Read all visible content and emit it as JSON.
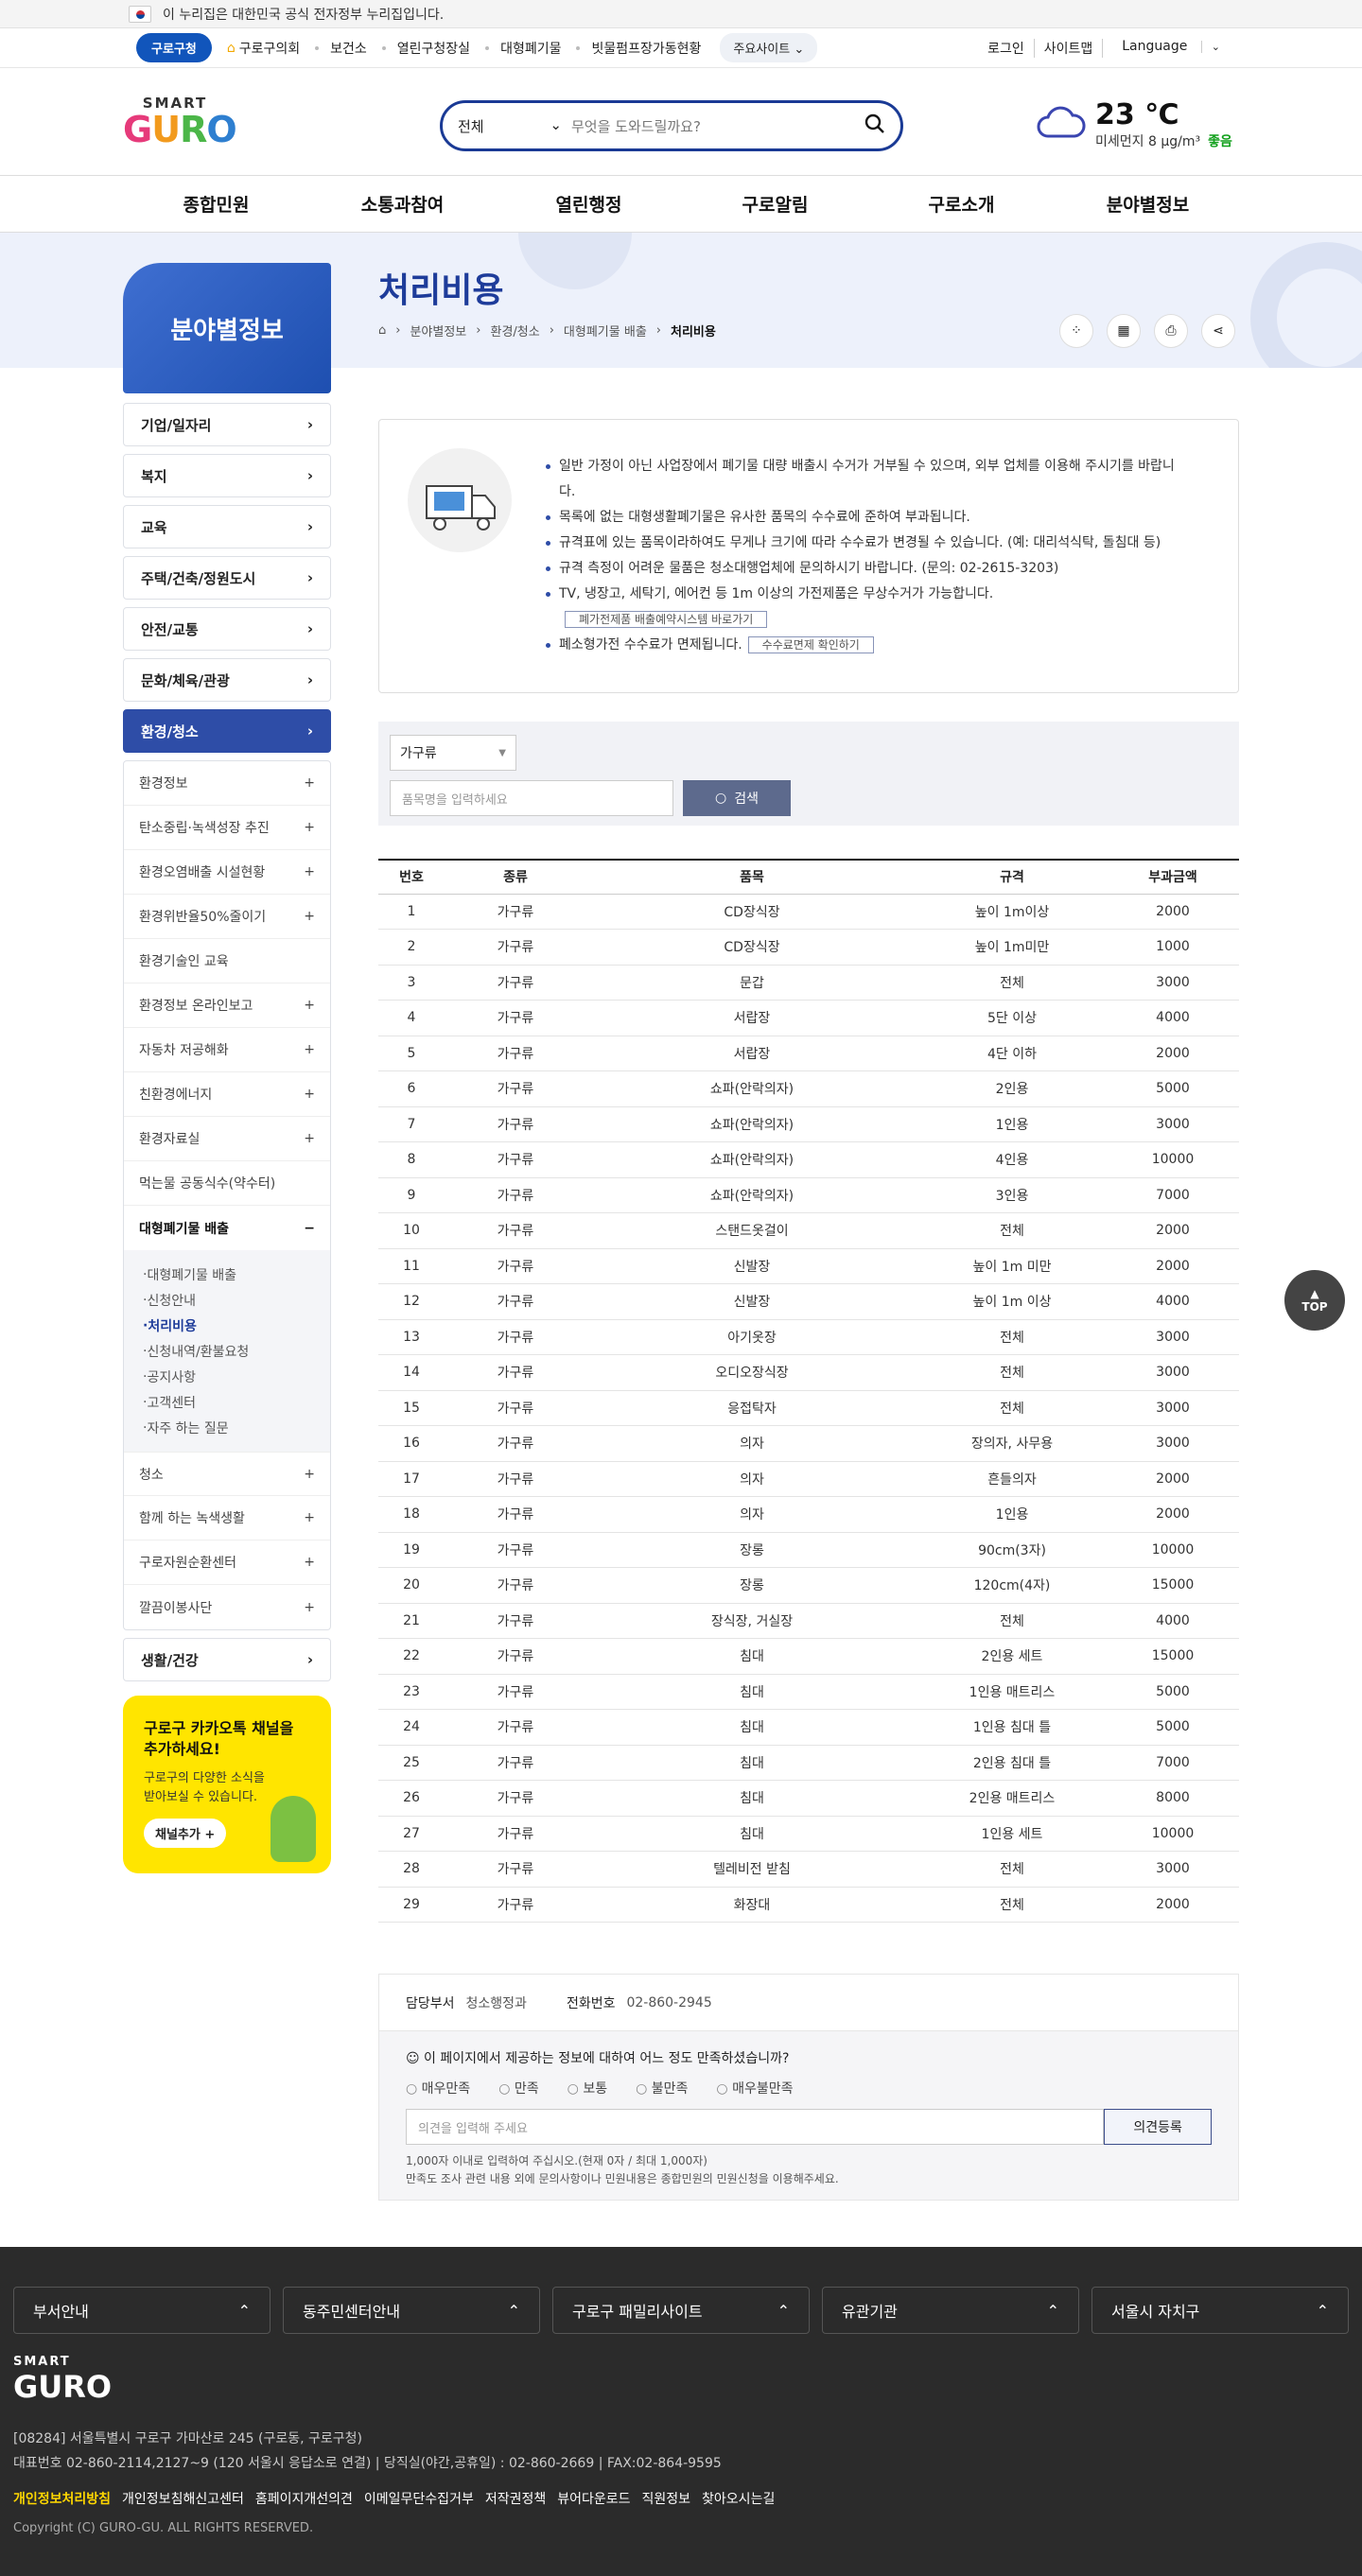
{
  "top": {
    "notice": "이 누리집은 대한민국 공식 전자정부 누리집입니다."
  },
  "gnbtop": {
    "guro": "구로구청",
    "links": [
      "구로구의회",
      "보건소",
      "열린구청장실",
      "대형폐기물",
      "빗물펌프장가동현황"
    ],
    "main_sites": "주요사이트",
    "util": [
      "로그인",
      "사이트맵",
      "Language"
    ]
  },
  "logo": {
    "smart": "SMART",
    "guro": "GURO"
  },
  "search": {
    "select": "전체",
    "placeholder": "무엇을 도와드릴까요?"
  },
  "weather": {
    "temp": "23 ℃",
    "dust": "미세먼지 8 µg/m³",
    "grade": "좋음"
  },
  "gnb": [
    "종합민원",
    "소통과참여",
    "열린행정",
    "구로알림",
    "구로소개",
    "분야별정보"
  ],
  "side_title": "분야별정보",
  "page_title": "처리비용",
  "breadcrumb": [
    "분야별정보",
    "환경/청소",
    "대형폐기물 배출",
    "처리비용"
  ],
  "lnb": {
    "top": [
      "기업/일자리",
      "복지",
      "교육",
      "주택/건축/정원도시",
      "안전/교통",
      "문화/체육/관광"
    ],
    "active": "환경/청소",
    "subs": [
      "환경정보",
      "탄소중립·녹색성장 추진",
      "환경오염배출 시설현황",
      "환경위반율50%줄이기",
      "환경기술인 교육",
      "환경정보 온라인보고",
      "자동차 저공해화",
      "친환경에너지",
      "환경자료실",
      "먹는물 공동식수(약수터)"
    ],
    "open": "대형폐기물 배출",
    "deep": [
      "대형폐기물 배출",
      "신청안내",
      "처리비용",
      "신청내역/환불요청",
      "공지사항",
      "고객센터",
      "자주 하는 질문"
    ],
    "subs2": [
      "청소",
      "함께 하는 녹색생활",
      "구로자원순환센터",
      "깔끔이봉사단"
    ],
    "last": "생활/건강"
  },
  "kakao": {
    "title1": "구로구 카카오톡 채널을",
    "title2": "추가하세요!",
    "desc1": "구로구의 다양한 소식을",
    "desc2": "받아보실 수 있습니다.",
    "btn": "채널추가 +"
  },
  "notice": {
    "items": [
      "일반 가정이 아닌 사업장에서 폐기물 대량 배출시 수거가 거부될 수 있으며, 외부 업체를 이용해 주시기를 바랍니다.",
      "목록에 없는 대형생활폐기물은 유사한 품목의 수수료에 준하여 부과됩니다.",
      "규격표에 있는 품목이라하여도 무게나 크기에 따라 수수료가 변경될 수 있습니다. (예: 대리석식탁, 돌침대 등)",
      "규격 측정이 어려운 물품은 청소대행업체에 문의하시기 바랍니다. (문의: 02-2615-3203)",
      "TV, 냉장고, 세탁기, 에어컨 등 1m 이상의 가전제품은 무상수거가 가능합니다.",
      "폐소형가전 수수료가 면제됩니다."
    ],
    "btn1": "폐가전제품 배출예약시스템 바로가기",
    "btn2": "수수료면제 확인하기"
  },
  "filter": {
    "select": "가구류",
    "placeholder": "품목명을 입력하세요",
    "search": "검색"
  },
  "table": {
    "headers": [
      "번호",
      "종류",
      "품목",
      "규격",
      "부과금액"
    ],
    "rows": [
      [
        "1",
        "가구류",
        "CD장식장",
        "높이 1m이상",
        "2000"
      ],
      [
        "2",
        "가구류",
        "CD장식장",
        "높이 1m미만",
        "1000"
      ],
      [
        "3",
        "가구류",
        "문갑",
        "전체",
        "3000"
      ],
      [
        "4",
        "가구류",
        "서랍장",
        "5단 이상",
        "4000"
      ],
      [
        "5",
        "가구류",
        "서랍장",
        "4단 이하",
        "2000"
      ],
      [
        "6",
        "가구류",
        "쇼파(안락의자)",
        "2인용",
        "5000"
      ],
      [
        "7",
        "가구류",
        "쇼파(안락의자)",
        "1인용",
        "3000"
      ],
      [
        "8",
        "가구류",
        "쇼파(안락의자)",
        "4인용",
        "10000"
      ],
      [
        "9",
        "가구류",
        "쇼파(안락의자)",
        "3인용",
        "7000"
      ],
      [
        "10",
        "가구류",
        "스탠드옷걸이",
        "전체",
        "2000"
      ],
      [
        "11",
        "가구류",
        "신발장",
        "높이 1m 미만",
        "2000"
      ],
      [
        "12",
        "가구류",
        "신발장",
        "높이 1m 이상",
        "4000"
      ],
      [
        "13",
        "가구류",
        "아기옷장",
        "전체",
        "3000"
      ],
      [
        "14",
        "가구류",
        "오디오장식장",
        "전체",
        "3000"
      ],
      [
        "15",
        "가구류",
        "응접탁자",
        "전체",
        "3000"
      ],
      [
        "16",
        "가구류",
        "의자",
        "장의자, 사무용",
        "3000"
      ],
      [
        "17",
        "가구류",
        "의자",
        "흔들의자",
        "2000"
      ],
      [
        "18",
        "가구류",
        "의자",
        "1인용",
        "2000"
      ],
      [
        "19",
        "가구류",
        "장롱",
        "90cm(3자)",
        "10000"
      ],
      [
        "20",
        "가구류",
        "장롱",
        "120cm(4자)",
        "15000"
      ],
      [
        "21",
        "가구류",
        "장식장, 거실장",
        "전체",
        "4000"
      ],
      [
        "22",
        "가구류",
        "침대",
        "2인용 세트",
        "15000"
      ],
      [
        "23",
        "가구류",
        "침대",
        "1인용 매트리스",
        "5000"
      ],
      [
        "24",
        "가구류",
        "침대",
        "1인용 침대 틀",
        "5000"
      ],
      [
        "25",
        "가구류",
        "침대",
        "2인용 침대 틀",
        "7000"
      ],
      [
        "26",
        "가구류",
        "침대",
        "2인용 매트리스",
        "8000"
      ],
      [
        "27",
        "가구류",
        "침대",
        "1인용 세트",
        "10000"
      ],
      [
        "28",
        "가구류",
        "텔레비전 받침",
        "전체",
        "3000"
      ],
      [
        "29",
        "가구류",
        "화장대",
        "전체",
        "2000"
      ]
    ]
  },
  "survey": {
    "dept_label": "담당부서",
    "dept": "청소행정과",
    "tel_label": "전화번호",
    "tel": "02-860-2945",
    "question": "이 페이지에서 제공하는 정보에 대하여 어느 정도 만족하셨습니까?",
    "options": [
      "매우만족",
      "만족",
      "보통",
      "불만족",
      "매우불만족"
    ],
    "placeholder": "의견을 입력해 주세요",
    "submit": "의견등록",
    "note1": "1,000자 이내로 입력하여 주십시오.(현재 0자 / 최대 1,000자)",
    "note2": "만족도 조사 관련 내용 외에 문의사항이나 민원내용은 종합민원의 민원신청을 이용해주세요."
  },
  "top_btn": "TOP",
  "footer": {
    "selects": [
      "부서안내",
      "동주민센터안내",
      "구로구 패밀리사이트",
      "유관기관",
      "서울시 자치구"
    ],
    "address": "[08284] 서울특별시 구로구 가마산로 245 (구로동, 구로구청)",
    "phone": "대표번호 02-860-2114,2127~9 (120 서울시 응답소로 연결) | 당직실(야간,공휴일) : 02-860-2669 | FAX:02-864-9595",
    "links": [
      "개인정보처리방침",
      "개인정보침해신고센터",
      "홈페이지개선의견",
      "이메일무단수집거부",
      "저작권정책",
      "뷰어다운로드",
      "직원정보",
      "찾아오시는길"
    ],
    "copyright": "Copyright (C) GURO-GU. ALL RIGHTS RESERVED."
  }
}
